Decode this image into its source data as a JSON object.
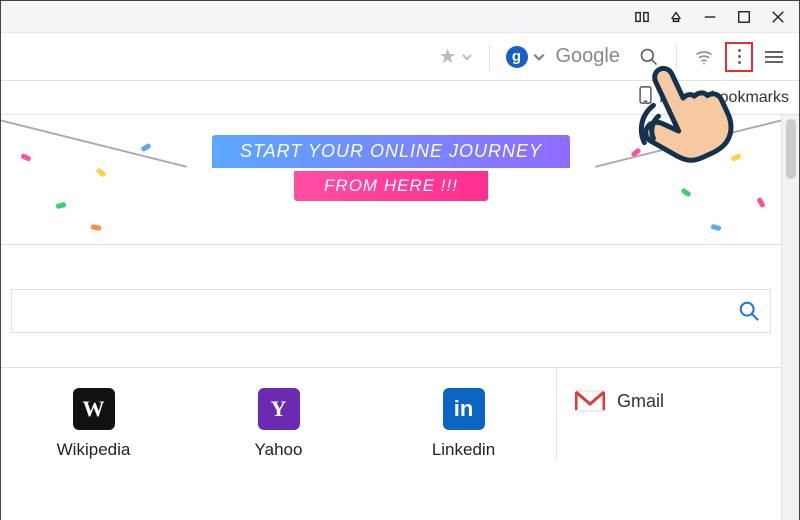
{
  "titlebar": {
    "icons": [
      "snap",
      "aero",
      "min",
      "max",
      "close"
    ]
  },
  "toolbar": {
    "search_provider_label": "Google",
    "search_provider_glyph": "g",
    "icons": {
      "star": "star-icon",
      "search": "search-icon",
      "wifi": "wifi-icon",
      "kebab": "kebab-menu-icon",
      "hamburger": "hamburger-menu-icon"
    }
  },
  "bookmarks_bar": {
    "mobile_bookmarks_label": "Mobile bookmarks",
    "mobile_bookmarks_label_partial_prefix": "M",
    "mobile_bookmarks_label_partial_suffix": "e bookmarks"
  },
  "banner": {
    "line1": "START YOUR ONLINE JOURNEY",
    "line2": "FROM HERE !!!"
  },
  "searchbox": {
    "placeholder": ""
  },
  "tiles": [
    {
      "label": "Wikipedia",
      "glyph": "W",
      "class": "wk"
    },
    {
      "label": "Yahoo",
      "glyph": "Y",
      "class": "yh"
    },
    {
      "label": "Linkedin",
      "glyph": "in",
      "class": "li"
    }
  ],
  "sidepanel": {
    "items": [
      {
        "label": "Gmail",
        "icon": "gmail-icon"
      }
    ]
  },
  "highlight_target": "kebab-menu"
}
